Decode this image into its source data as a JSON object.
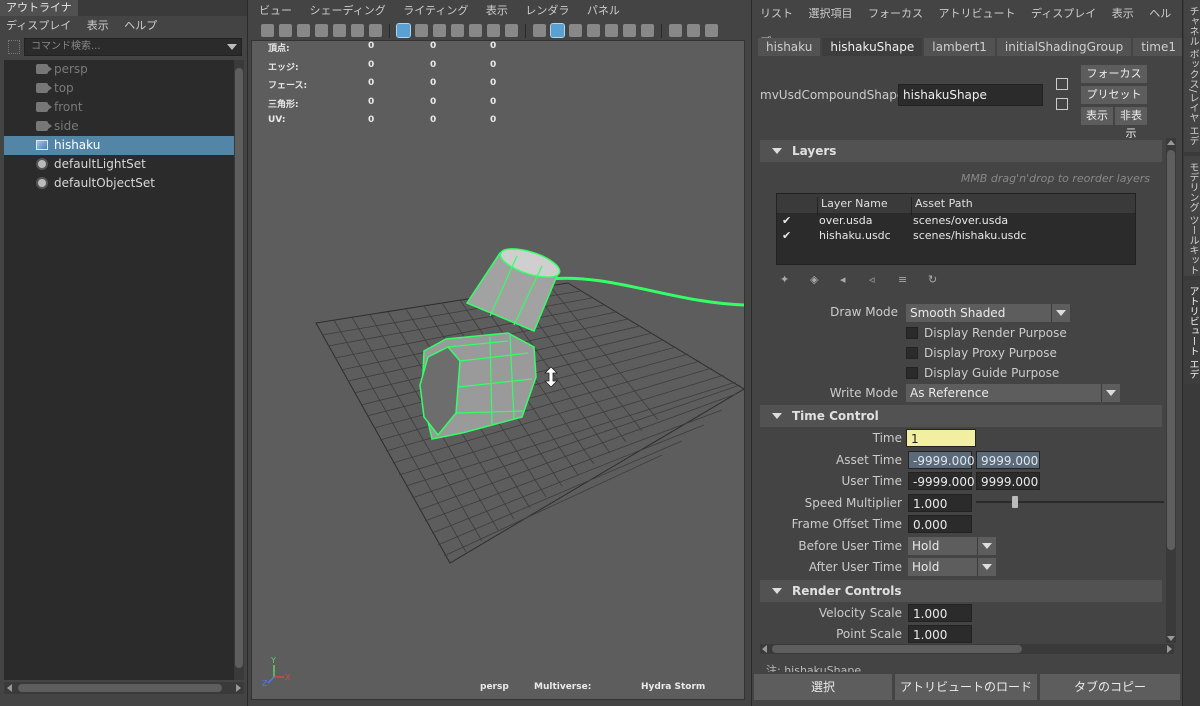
{
  "outliner": {
    "tab": "アウトライナ",
    "menu": [
      "ディスプレイ",
      "表示",
      "ヘルプ"
    ],
    "search_placeholder": "コマンド検索...",
    "items": [
      {
        "label": "persp",
        "icon": "camera-icon",
        "dim": true
      },
      {
        "label": "top",
        "icon": "camera-icon",
        "dim": true
      },
      {
        "label": "front",
        "icon": "camera-icon",
        "dim": true
      },
      {
        "label": "side",
        "icon": "camera-icon",
        "dim": true
      },
      {
        "label": "hishaku",
        "icon": "usd-stage-icon",
        "selected": true
      },
      {
        "label": "defaultLightSet",
        "icon": "set-icon"
      },
      {
        "label": "defaultObjectSet",
        "icon": "set-icon"
      }
    ]
  },
  "viewport": {
    "menu": [
      "ビュー",
      "シェーディング",
      "ライティング",
      "表示",
      "レンダラ",
      "パネル"
    ],
    "hud_rows": [
      {
        "label": "頂点:",
        "a": "0",
        "b": "0",
        "c": "0"
      },
      {
        "label": "エッジ:",
        "a": "0",
        "b": "0",
        "c": "0"
      },
      {
        "label": "フェース:",
        "a": "0",
        "b": "0",
        "c": "0"
      },
      {
        "label": "三角形:",
        "a": "0",
        "b": "0",
        "c": "0"
      },
      {
        "label": "UV:",
        "a": "0",
        "b": "0",
        "c": "0"
      }
    ],
    "camera": "persp",
    "plugin": "Multiverse:",
    "renderer": "Hydra Storm",
    "wire_color": "#33ff66"
  },
  "ae": {
    "menu": [
      "リスト",
      "選択項目",
      "フォーカス",
      "アトリビュート",
      "ディスプレイ",
      "表示",
      "ヘルプ"
    ],
    "node_tabs": [
      "hishaku",
      "hishakuShape",
      "lambert1",
      "initialShadingGroup",
      "time1"
    ],
    "active_tab": "hishakuShape",
    "shape_label": "mvUsdCompoundShape:",
    "shape_value": "hishakuShape",
    "focus_btn": "フォーカス",
    "preset_btn": "プリセット",
    "show_btn": "表示",
    "hide_btn": "非表示",
    "layers": {
      "title": "Layers",
      "hint": "MMB drag'n'drop to reorder layers",
      "col_name": "Layer Name",
      "col_path": "Asset Path",
      "rows": [
        {
          "check": "✔",
          "name": "over.usda",
          "path": "scenes/over.usda"
        },
        {
          "check": "✔",
          "name": "hishaku.usdc",
          "path": "scenes/hishaku.usdc"
        }
      ]
    },
    "draw_mode_label": "Draw Mode",
    "draw_mode": "Smooth Shaded",
    "purposes": [
      "Display Render Purpose",
      "Display Proxy Purpose",
      "Display Guide Purpose"
    ],
    "write_mode_label": "Write Mode",
    "write_mode": "As Reference",
    "time_control": {
      "title": "Time Control",
      "time_label": "Time",
      "time": "1",
      "asset_time_label": "Asset Time",
      "asset_start": "-9999.000",
      "asset_end": "9999.000",
      "user_time_label": "User Time",
      "user_start": "-9999.000",
      "user_end": "9999.000",
      "speed_label": "Speed Multiplier",
      "speed": "1.000",
      "frame_offset_label": "Frame Offset Time",
      "frame_offset": "0.000",
      "before_label": "Before User Time",
      "before": "Hold",
      "after_label": "After User Time",
      "after": "Hold"
    },
    "render_controls": {
      "title": "Render Controls",
      "velocity_label": "Velocity Scale",
      "velocity": "1.000",
      "point_label": "Point Scale",
      "point": "1.000"
    },
    "footnote": "注: hishakuShape",
    "buttons": [
      "選択",
      "アトリビュートのロード",
      "タブのコピー"
    ]
  },
  "side_tabs": [
    "チャネル ボックス/レイヤ エディタ",
    "モデリング ツールキット",
    "アトリビュート エディタ"
  ]
}
